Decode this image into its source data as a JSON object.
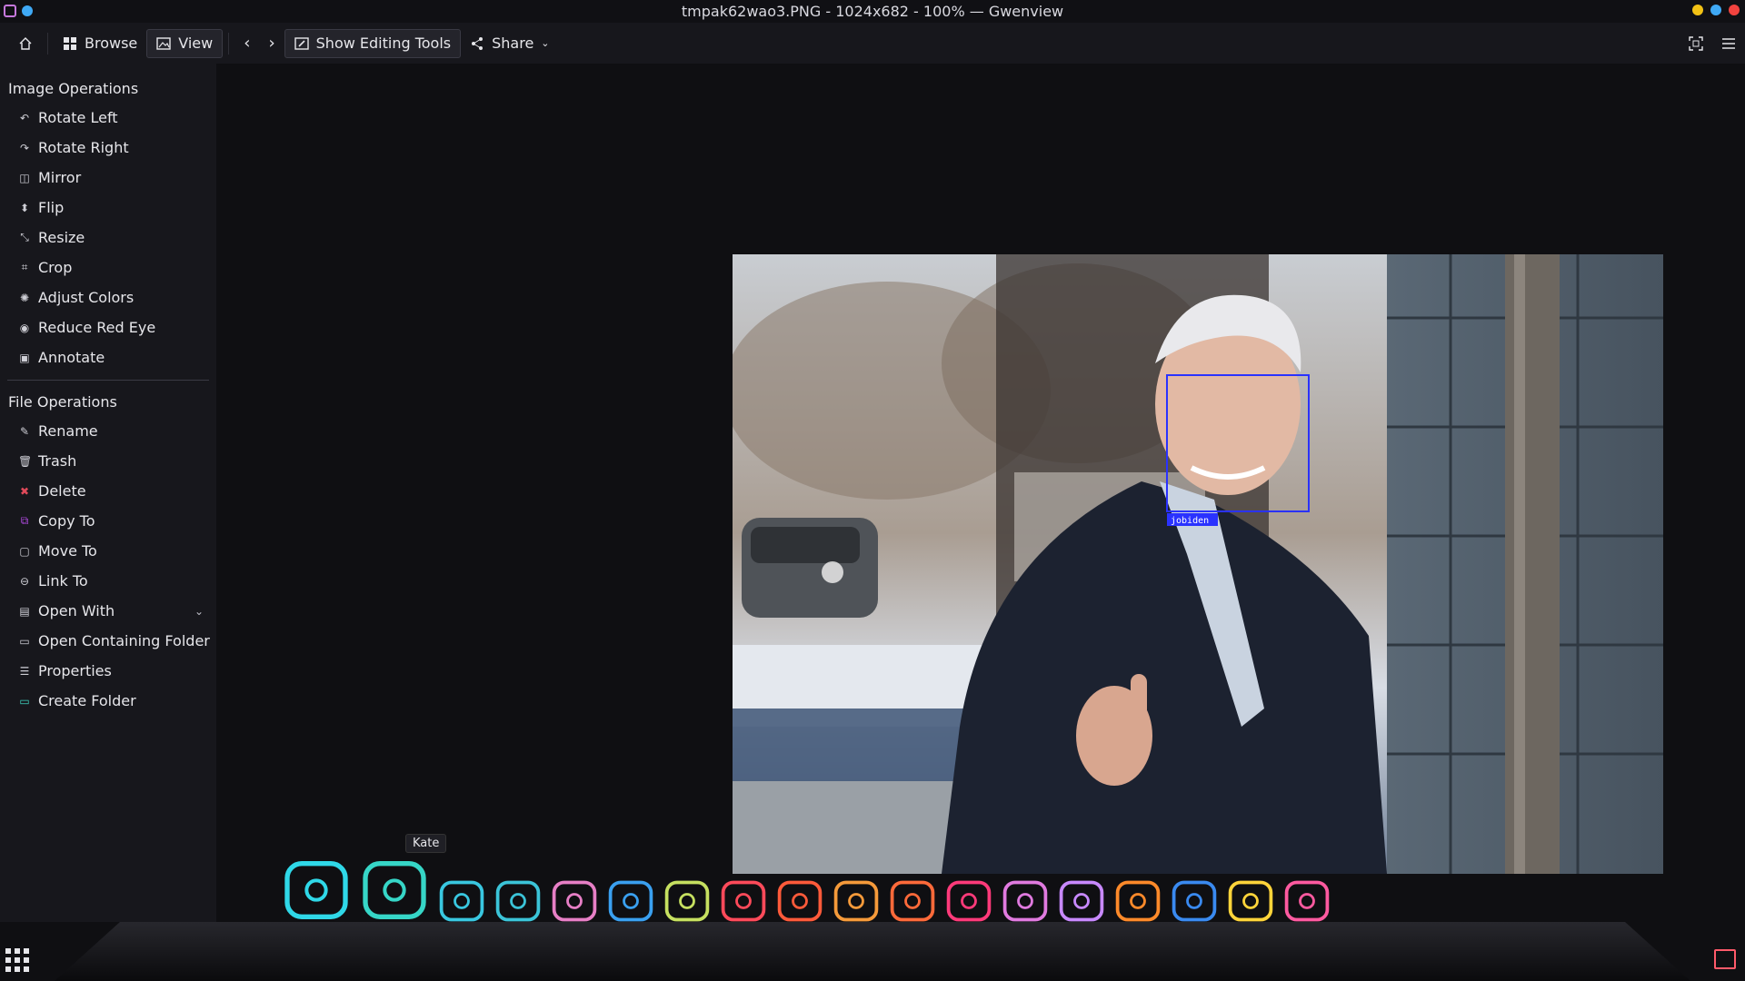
{
  "window": {
    "title": "tmpak62wao3.PNG - 1024x682 - 100% — Gwenview",
    "accent": "#c678dd",
    "traffic_colors": [
      "#f2c215",
      "#3fa9f5",
      "#f2433f"
    ]
  },
  "toolbar": {
    "home_label": "",
    "browse_label": "Browse",
    "view_label": "View",
    "show_editing_tools_label": "Show Editing Tools",
    "share_label": "Share"
  },
  "sidebar": {
    "image_ops_title": "Image Operations",
    "image_ops": [
      {
        "label": "Rotate Left",
        "icon": "rotate-left-icon",
        "glyph": "↶"
      },
      {
        "label": "Rotate Right",
        "icon": "rotate-right-icon",
        "glyph": "↷"
      },
      {
        "label": "Mirror",
        "icon": "mirror-icon",
        "glyph": "◫"
      },
      {
        "label": "Flip",
        "icon": "flip-icon",
        "glyph": "⬍"
      },
      {
        "label": "Resize",
        "icon": "resize-icon",
        "glyph": "⤡"
      },
      {
        "label": "Crop",
        "icon": "crop-icon",
        "glyph": "⌗"
      },
      {
        "label": "Adjust Colors",
        "icon": "adjust-colors-icon",
        "glyph": "✺"
      },
      {
        "label": "Reduce Red Eye",
        "icon": "red-eye-icon",
        "glyph": "◉"
      },
      {
        "label": "Annotate",
        "icon": "annotate-icon",
        "glyph": "▣"
      }
    ],
    "file_ops_title": "File Operations",
    "file_ops": [
      {
        "label": "Rename",
        "icon": "rename-icon",
        "glyph": "✎"
      },
      {
        "label": "Trash",
        "icon": "trash-icon",
        "glyph": "🗑"
      },
      {
        "label": "Delete",
        "icon": "delete-icon",
        "glyph": "✖",
        "color": "#e04a5a"
      },
      {
        "label": "Copy To",
        "icon": "copy-icon",
        "glyph": "⧉",
        "color": "#b04ae0"
      },
      {
        "label": "Move To",
        "icon": "move-icon",
        "glyph": "▢"
      },
      {
        "label": "Link To",
        "icon": "link-icon",
        "glyph": "⊖"
      },
      {
        "label": "Open With",
        "icon": "open-with-icon",
        "glyph": "▤"
      },
      {
        "label": "Open Containing Folder",
        "icon": "folder-icon",
        "glyph": "▭"
      },
      {
        "label": "Properties",
        "icon": "properties-icon",
        "glyph": "☰"
      },
      {
        "label": "Create Folder",
        "icon": "create-folder-icon",
        "glyph": "▭",
        "color": "#3fd4c0"
      }
    ]
  },
  "image": {
    "annotation_label": "jobiden"
  },
  "dock": {
    "tooltip": "Kate",
    "apps": [
      "terminal-icon",
      "kate-icon",
      "qbittorrent-icon",
      "dolphin-icon",
      "image-viewer-icon",
      "chrome-icon",
      "box-icon",
      "arch-icon",
      "vlc-icon",
      "settings-icon",
      "vm-icon",
      "firefox-icon",
      "krita-icon",
      "document-viewer-icon",
      "folder-pictures-icon",
      "writer-icon",
      "usb-icon",
      "camera-icon"
    ]
  }
}
